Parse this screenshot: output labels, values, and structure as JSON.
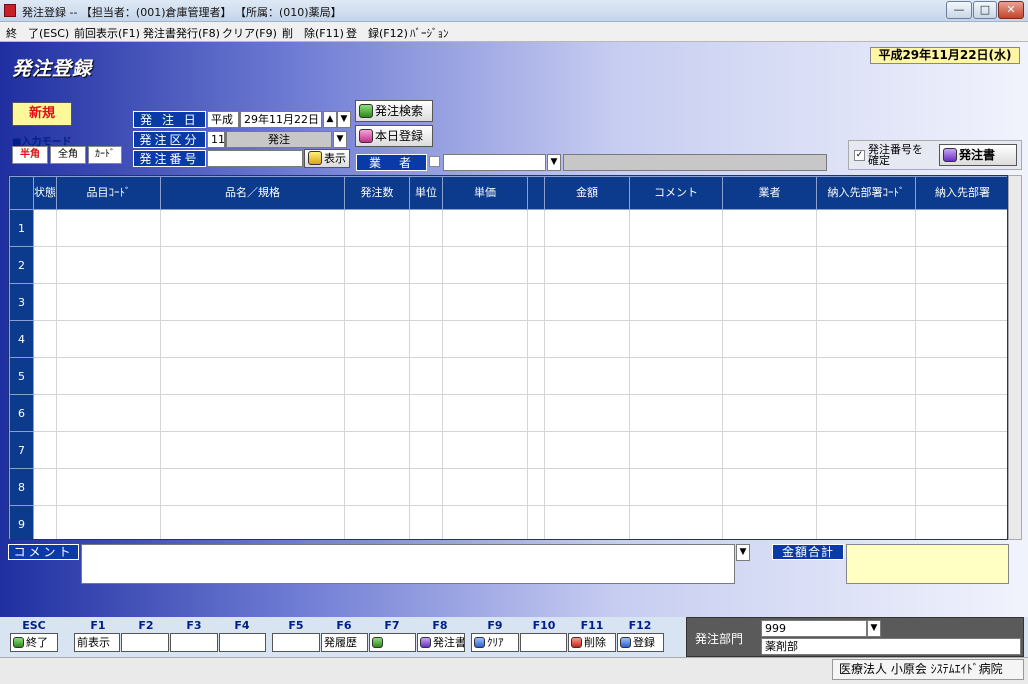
{
  "window": {
    "title": "発注登録 -- 【担当者：(001)倉庫管理者】 【所属：(010)薬局】",
    "min_label": "—",
    "max_label": "□",
    "close_label": "✕"
  },
  "menu": [
    "終　了(ESC)",
    "前回表示(F1)",
    "発注書発行(F8)",
    "クリア(F9)",
    "削　除(F11)",
    "登　録(F12)",
    "ﾊﾞｰｼﾞｮﾝ"
  ],
  "header": {
    "screen_title": "発注登録",
    "date": "平成29年11月22日(水)"
  },
  "form": {
    "new_badge": "新規",
    "input_mode_label": "■入力モード",
    "modes": [
      "半角",
      "全角",
      "ｶｰﾄﾞ"
    ],
    "order_date_label": "発 注 日",
    "era": "平成",
    "order_date": "29年11月22日",
    "order_type_label": "発注区分",
    "order_type_code": "11",
    "order_type_name": "発注",
    "order_no_label": "発注番号",
    "order_no": "",
    "show_label": "表示",
    "search_label": "発注検索",
    "today_label": "本日登録",
    "vendor_label": "業　者",
    "vendor_value": "",
    "confirm_line1": "発注番号を",
    "confirm_line2": "確定",
    "order_sheet_label": "発注書"
  },
  "grid": {
    "headers": [
      "状態",
      "品目ｺｰﾄﾞ",
      "品名／規格",
      "発注数",
      "単位",
      "単価",
      "",
      "金額",
      "コメント",
      "業者",
      "納入先部署ｺｰﾄﾞ",
      "納入先部署"
    ],
    "row_numbers": [
      "1",
      "2",
      "3",
      "4",
      "5",
      "6",
      "7",
      "8",
      "9"
    ]
  },
  "footer_fields": {
    "comment_label": "コメント",
    "total_label": "金額合計"
  },
  "fkeys": [
    {
      "key": "ESC",
      "label": "終了",
      "icon": "exit-icon"
    },
    {
      "key": "F1",
      "label": "前表示",
      "icon": ""
    },
    {
      "key": "F2",
      "label": "",
      "icon": ""
    },
    {
      "key": "F3",
      "label": "",
      "icon": ""
    },
    {
      "key": "F4",
      "label": "",
      "icon": ""
    },
    {
      "key": "F5",
      "label": "",
      "icon": ""
    },
    {
      "key": "F6",
      "label": "発履歴",
      "icon": ""
    },
    {
      "key": "F7",
      "label": "",
      "icon": "search-icon"
    },
    {
      "key": "F8",
      "label": "発注書",
      "icon": "print-icon"
    },
    {
      "key": "F9",
      "label": "ｸﾘｱ",
      "icon": "clear-icon"
    },
    {
      "key": "F10",
      "label": "",
      "icon": ""
    },
    {
      "key": "F11",
      "label": "削除",
      "icon": "delete-icon"
    },
    {
      "key": "F12",
      "label": "登録",
      "icon": "save-icon"
    }
  ],
  "dept": {
    "label": "発注部門",
    "code": "999",
    "name": "薬剤部"
  },
  "status": {
    "org": "医療法人 小原会 ｼｽﾃﾑｴｲﾄﾞ病院"
  }
}
